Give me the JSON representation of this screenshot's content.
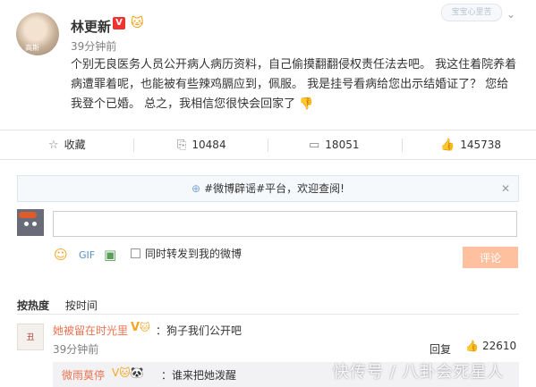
{
  "post": {
    "avatar_caption": "高斯",
    "username": "林更新",
    "verified_badge": "V",
    "vip_icon": "vip-cat-icon",
    "time": "39分钟前",
    "content": "个别无良医务人员公开病人病历资料，自己偷摸翻翻侵权责任法去吧。 我这住着院养着病遭罪着呢，也能被有些辣鸡膈应到，佩服。 我是挂号看病给您出示结婚证了？ 您给我登个已婚。 总之，我相信您很快会回家了",
    "emoji": "👎",
    "top_watermark": "宝宝心里苦"
  },
  "actions": {
    "favorite": {
      "icon": "star-icon",
      "label": "收藏"
    },
    "repost": {
      "icon": "repost-icon",
      "label": "10484"
    },
    "comment": {
      "icon": "comment-icon",
      "label": "18051"
    },
    "like": {
      "icon": "thumbs-up-icon",
      "label": "145738"
    }
  },
  "notice": {
    "icon": "hash-icon",
    "text": "#微博辟谣#平台，欢迎查阅!",
    "close": "✕"
  },
  "composer": {
    "placeholder": "",
    "repost_label": "同时转发到我的微博",
    "submit_label": "评论"
  },
  "sort": {
    "hot": "按热度",
    "time": "按时间"
  },
  "comment": {
    "avatar_text": "丑",
    "username": "她被留在时光里",
    "text": "：狗子我们公开吧",
    "time": "39分钟前",
    "reply": "回复",
    "likes": "22610"
  },
  "sub_comment": {
    "username": "微雨莫停",
    "text": "：谁来把她泼醒"
  },
  "watermark": "快传号 / 八卦会死星人"
}
